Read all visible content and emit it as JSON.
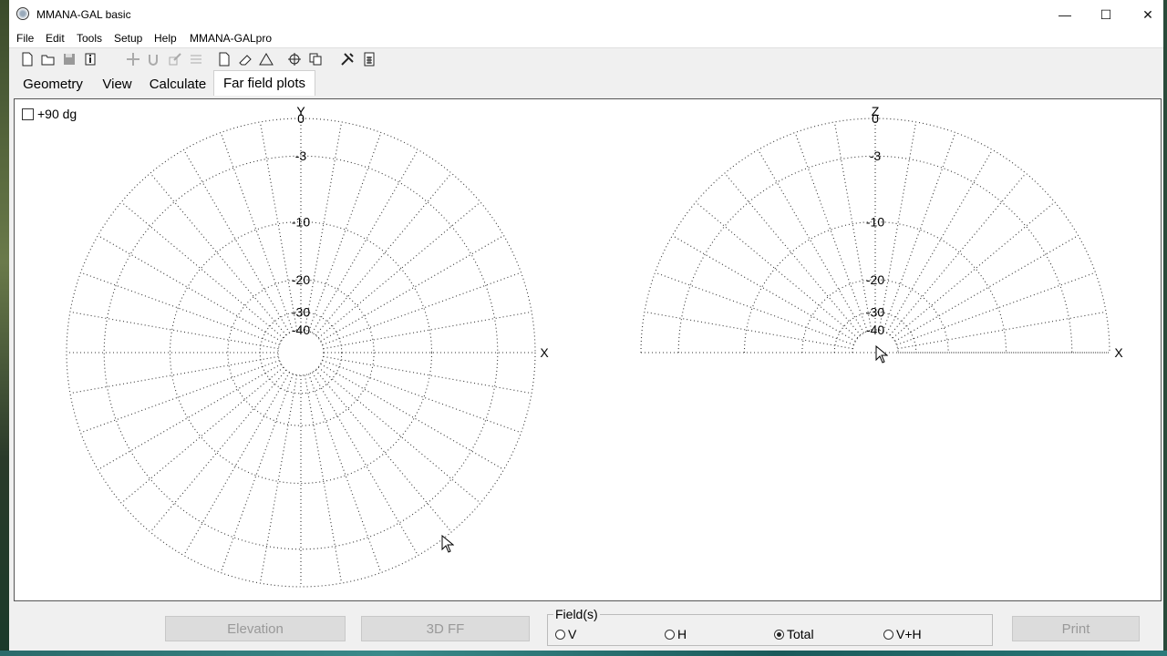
{
  "window": {
    "title": "MMANA-GAL basic",
    "minimize_glyph": "—",
    "maximize_glyph": "☐",
    "close_glyph": "✕"
  },
  "menu": [
    "File",
    "Edit",
    "Tools",
    "Setup",
    "Help",
    "MMANA-GALpro"
  ],
  "toolbar_icons": [
    "new-file-icon",
    "open-folder-icon",
    "save-icon",
    "info-icon",
    "move-icon",
    "rotate-icon",
    "stretch-icon",
    "align-icon",
    "page-icon",
    "eraser-icon",
    "triangle-icon",
    "target-icon",
    "copy-icon",
    "tools-icon",
    "calculator-icon"
  ],
  "tabs": {
    "items": [
      "Geometry",
      "View",
      "Calculate",
      "Far field plots"
    ],
    "active": "Far field plots"
  },
  "plot": {
    "checkbox_label": "+90 dg",
    "checkbox_checked": false,
    "left": {
      "top_axis": "Y",
      "right_axis": "X"
    },
    "right": {
      "top_axis": "Z",
      "right_axis": "X"
    },
    "ring_labels": [
      "0",
      "-3",
      "-10",
      "-20",
      "-30",
      "-40"
    ],
    "ring_db": [
      0,
      -3,
      -10,
      -20,
      -30,
      -40
    ]
  },
  "bottom": {
    "elevation": "Elevation",
    "ff3d": "3D FF",
    "fields_legend": "Field(s)",
    "radios": [
      {
        "label": "V",
        "checked": false
      },
      {
        "label": "H",
        "checked": false
      },
      {
        "label": "Total",
        "checked": true
      },
      {
        "label": "V+H",
        "checked": false
      }
    ],
    "print": "Print"
  }
}
